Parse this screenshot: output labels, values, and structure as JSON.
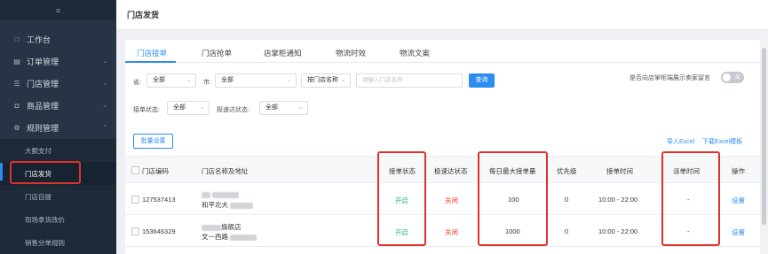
{
  "sidebar": {
    "toggle_icon": "≡",
    "items": [
      {
        "label": "工作台",
        "icon": "monitor-icon",
        "glyph": "□"
      },
      {
        "label": "订单管理",
        "icon": "document-icon",
        "glyph": "▤"
      },
      {
        "label": "门店管理",
        "icon": "list-icon",
        "glyph": "☰"
      },
      {
        "label": "商品管理",
        "icon": "lock-icon",
        "glyph": "◘"
      },
      {
        "label": "规则管理",
        "icon": "gear-icon",
        "glyph": "⚙"
      }
    ],
    "subitems": [
      "大额支付",
      "门店发货",
      "门店自提",
      "现场拿货改价",
      "销售分单规则"
    ]
  },
  "header": {
    "title": "门店发货"
  },
  "tabs": [
    "门店接单",
    "门店抢单",
    "店掌柜通知",
    "物流时效",
    "物流文案"
  ],
  "filters": {
    "province_label": "省:",
    "province_value": "全部",
    "city_label": "市:",
    "city_value": "全部",
    "store_select": "按门店名称",
    "store_placeholder": "请输入门店名称",
    "search_button": "查询",
    "accept_status_label": "接单状态:",
    "accept_status_value": "全部",
    "express_status_label": "极速达状态:",
    "express_status_value": "全部",
    "toggle_label": "是否向店掌柜端展示卖家留言",
    "toggle_text": "关"
  },
  "actions": {
    "batch_button": "批量设置",
    "import_link": "导入Excel",
    "download_link": "下载Excel模板"
  },
  "table": {
    "headers": [
      "门店编码",
      "门店名称及地址",
      "接单状态",
      "极速达状态",
      "每日最大接单量",
      "优先级",
      "接单时间",
      "派单时间",
      "操作"
    ],
    "rows": [
      {
        "code": "127537413",
        "name_line1": "",
        "name_line2": "和平北大",
        "accept": "开启",
        "express": "关闭",
        "max": "100",
        "priority": "0",
        "time": "10:00  -  22:00",
        "dispatch": "-",
        "op": "设置"
      },
      {
        "code": "153646329",
        "name_line1": "旗舰店",
        "name_line2": "文一西路",
        "accept": "开启",
        "express": "关闭",
        "max": "1000",
        "priority": "0",
        "time": "10:00  -  22:00",
        "dispatch": "-",
        "op": "设置"
      }
    ]
  },
  "colors": {
    "accent": "#2d8cf0",
    "sidebar_bg": "#263445",
    "on": "#19be6b",
    "off": "#ed4014",
    "highlight": "#e0312b"
  }
}
